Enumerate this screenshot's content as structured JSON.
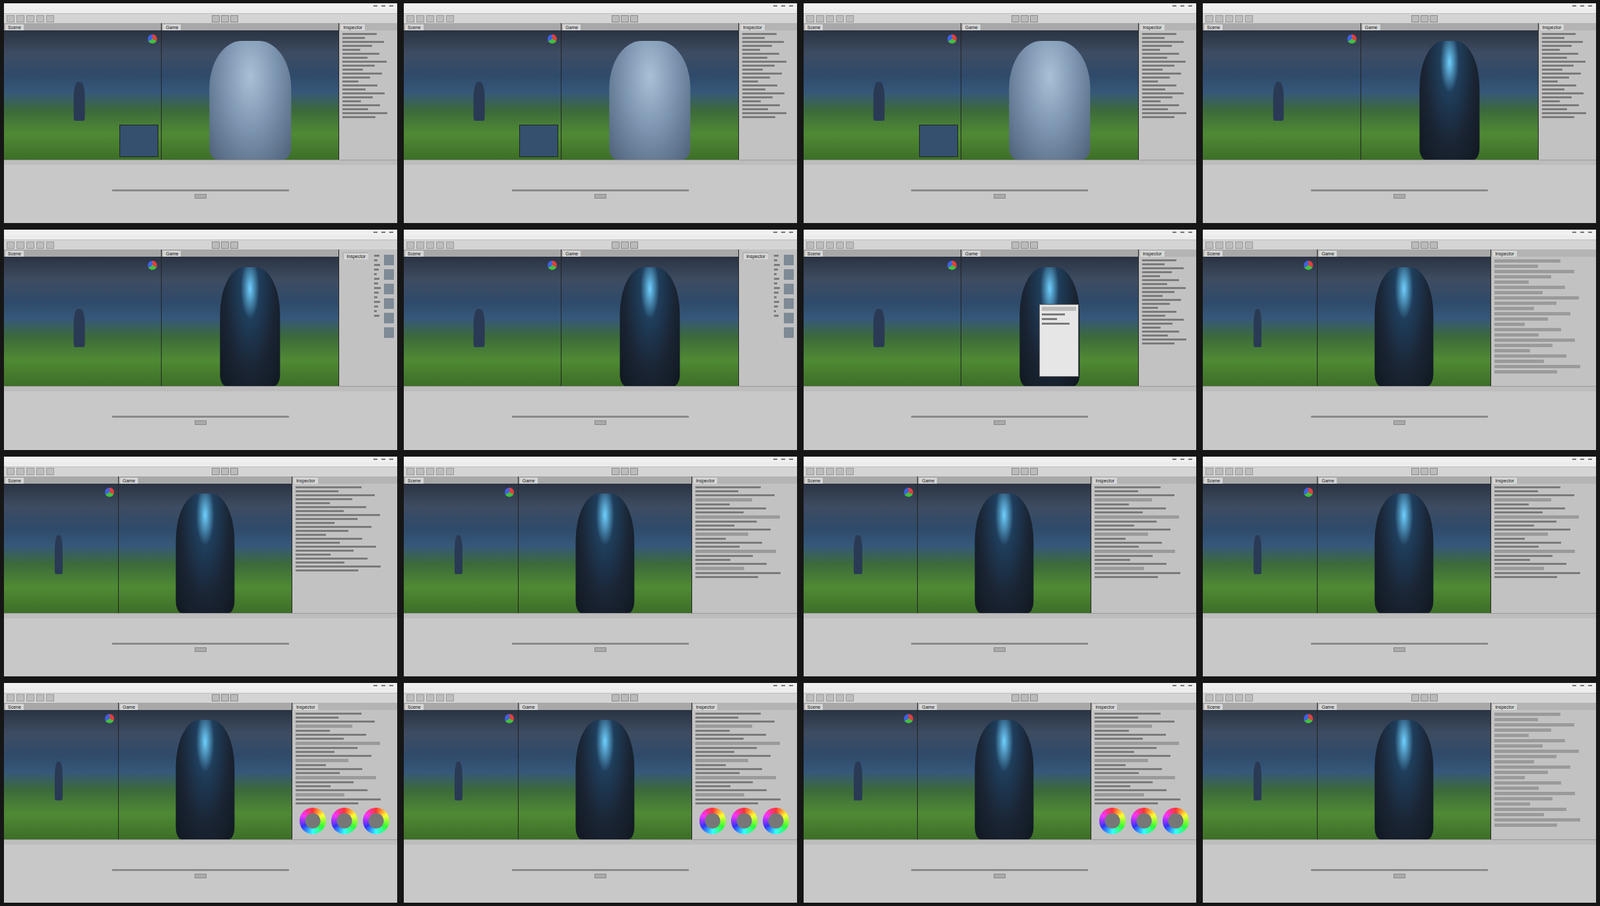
{
  "sheet": {
    "columns": 4,
    "rows": 4
  },
  "editor": {
    "tabs": [
      "Scene",
      "Game",
      "Inspector"
    ]
  },
  "frames": [
    {
      "subject": "troll",
      "panel": "inspector",
      "wide": false,
      "dialog": false,
      "preview": true,
      "wheels": 0
    },
    {
      "subject": "troll",
      "panel": "inspector",
      "wide": false,
      "dialog": false,
      "preview": true,
      "wheels": 0
    },
    {
      "subject": "troll",
      "panel": "inspector",
      "wide": false,
      "dialog": false,
      "preview": true,
      "wheels": 0
    },
    {
      "subject": "knight",
      "panel": "inspector",
      "wide": false,
      "dialog": false,
      "preview": false,
      "wheels": 0
    },
    {
      "subject": "knight",
      "panel": "project",
      "wide": false,
      "dialog": false,
      "preview": false,
      "wheels": 0
    },
    {
      "subject": "knight",
      "panel": "project",
      "wide": false,
      "dialog": false,
      "preview": false,
      "wheels": 0
    },
    {
      "subject": "knight",
      "panel": "inspector",
      "wide": false,
      "dialog": true,
      "preview": false,
      "wheels": 0
    },
    {
      "subject": "knight",
      "panel": "list",
      "wide": true,
      "dialog": false,
      "preview": false,
      "wheels": 0
    },
    {
      "subject": "knight",
      "panel": "inspector",
      "wide": true,
      "dialog": false,
      "preview": false,
      "wheels": 0
    },
    {
      "subject": "knight",
      "panel": "volume",
      "wide": true,
      "dialog": false,
      "preview": false,
      "wheels": 0
    },
    {
      "subject": "knight",
      "panel": "volume",
      "wide": true,
      "dialog": false,
      "preview": false,
      "wheels": 0
    },
    {
      "subject": "knight",
      "panel": "volume",
      "wide": true,
      "dialog": false,
      "preview": false,
      "wheels": 0
    },
    {
      "subject": "knight",
      "panel": "volume",
      "wide": true,
      "dialog": false,
      "preview": false,
      "wheels": 3
    },
    {
      "subject": "knight",
      "panel": "volume",
      "wide": true,
      "dialog": false,
      "preview": false,
      "wheels": 3
    },
    {
      "subject": "knight",
      "panel": "volume",
      "wide": true,
      "dialog": false,
      "preview": false,
      "wheels": 3
    },
    {
      "subject": "knight",
      "panel": "list",
      "wide": true,
      "dialog": false,
      "preview": false,
      "wheels": 0
    }
  ]
}
